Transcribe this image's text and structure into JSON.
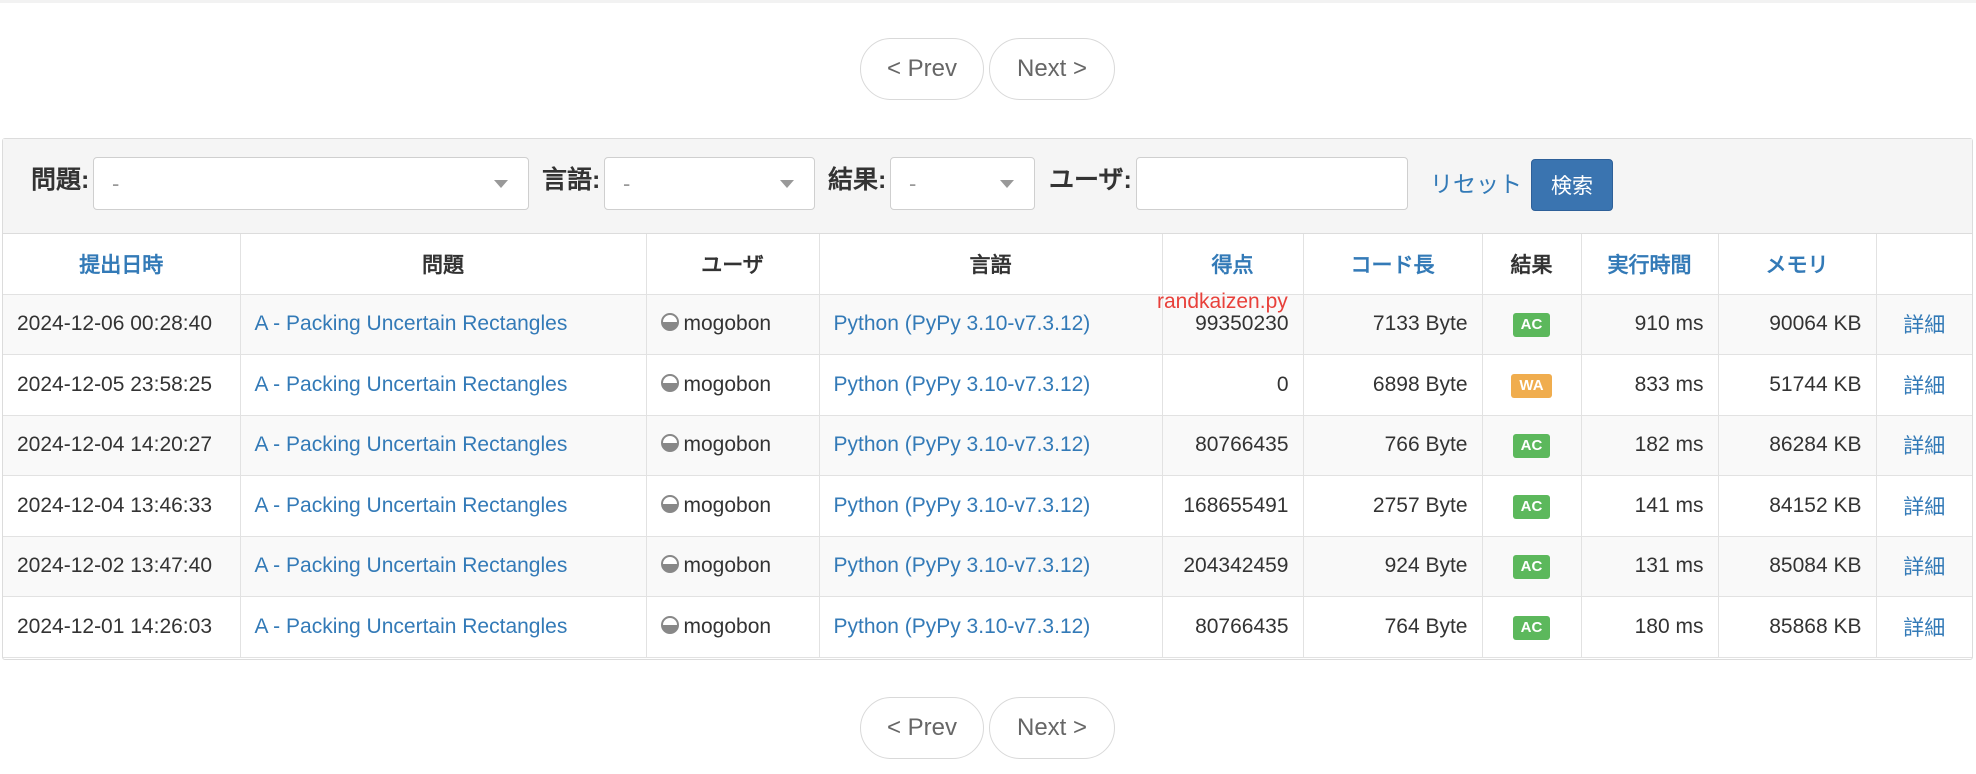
{
  "pager": {
    "prev_label": "< Prev",
    "next_label": "Next >"
  },
  "filters": {
    "problem_label": "問題:",
    "problem_value": "-",
    "language_label": "言語:",
    "language_value": "-",
    "result_label": "結果:",
    "result_value": "-",
    "user_label": "ユーザ:",
    "user_value": "",
    "reset_label": "リセット",
    "search_label": "検索"
  },
  "table": {
    "headers": {
      "submitted": "提出日時",
      "problem": "問題",
      "user": "ユーザ",
      "language": "言語",
      "score": "得点",
      "code_length": "コード長",
      "result": "結果",
      "exec_time": "実行時間",
      "memory": "メモリ",
      "detail": ""
    },
    "rows": [
      {
        "submitted": "2024-12-06 00:28:40",
        "problem": "A - Packing Uncertain Rectangles",
        "user": "mogobon",
        "language": "Python (PyPy 3.10-v7.3.12)",
        "score": "99350230",
        "code_length": "7133 Byte",
        "result": "AC",
        "exec_time": "910 ms",
        "memory": "90064 KB",
        "detail": "詳細"
      },
      {
        "submitted": "2024-12-05 23:58:25",
        "problem": "A - Packing Uncertain Rectangles",
        "user": "mogobon",
        "language": "Python (PyPy 3.10-v7.3.12)",
        "score": "0",
        "code_length": "6898 Byte",
        "result": "WA",
        "exec_time": "833 ms",
        "memory": "51744 KB",
        "detail": "詳細"
      },
      {
        "submitted": "2024-12-04 14:20:27",
        "problem": "A - Packing Uncertain Rectangles",
        "user": "mogobon",
        "language": "Python (PyPy 3.10-v7.3.12)",
        "score": "80766435",
        "code_length": "766 Byte",
        "result": "AC",
        "exec_time": "182 ms",
        "memory": "86284 KB",
        "detail": "詳細"
      },
      {
        "submitted": "2024-12-04 13:46:33",
        "problem": "A - Packing Uncertain Rectangles",
        "user": "mogobon",
        "language": "Python (PyPy 3.10-v7.3.12)",
        "score": "168655491",
        "code_length": "2757 Byte",
        "result": "AC",
        "exec_time": "141 ms",
        "memory": "84152 KB",
        "detail": "詳細"
      },
      {
        "submitted": "2024-12-02 13:47:40",
        "problem": "A - Packing Uncertain Rectangles",
        "user": "mogobon",
        "language": "Python (PyPy 3.10-v7.3.12)",
        "score": "204342459",
        "code_length": "924 Byte",
        "result": "AC",
        "exec_time": "131 ms",
        "memory": "85084 KB",
        "detail": "詳細"
      },
      {
        "submitted": "2024-12-01 14:26:03",
        "problem": "A - Packing Uncertain Rectangles",
        "user": "mogobon",
        "language": "Python (PyPy 3.10-v7.3.12)",
        "score": "80766435",
        "code_length": "764 Byte",
        "result": "AC",
        "exec_time": "180 ms",
        "memory": "85868 KB",
        "detail": "詳細"
      }
    ]
  },
  "overlay_text": "randkaizen.py",
  "colors": {
    "link": "#337ab7",
    "ac_badge": "#5cb85c",
    "wa_badge": "#f0ad4e",
    "search_button": "#3a74b0",
    "overlay_text": "#e8403a"
  },
  "icons": {
    "user": "user-avatar-icon",
    "dropdown": "chevron-down-icon"
  }
}
